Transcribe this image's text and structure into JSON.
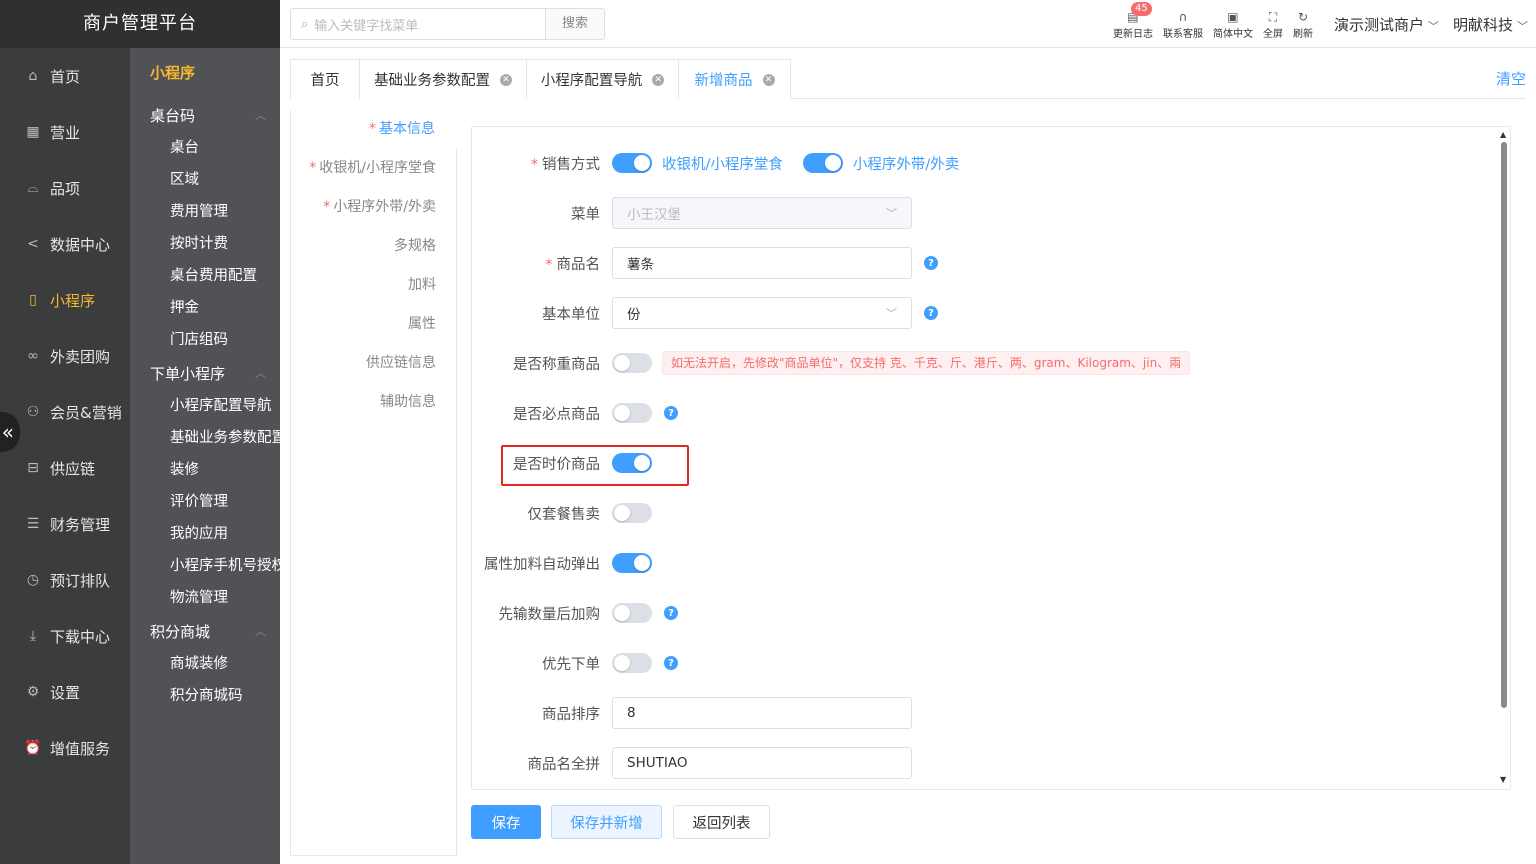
{
  "app_title": "商户管理平台",
  "primary_nav": [
    {
      "label": "首页",
      "icon": "home-icon"
    },
    {
      "label": "营业",
      "icon": "calendar-icon"
    },
    {
      "label": "品项",
      "icon": "bag-icon"
    },
    {
      "label": "数据中心",
      "icon": "share-icon"
    },
    {
      "label": "小程序",
      "icon": "phone-icon",
      "active": true
    },
    {
      "label": "外卖团购",
      "icon": "bike-icon"
    },
    {
      "label": "会员&营销",
      "icon": "user-icon"
    },
    {
      "label": "供应链",
      "icon": "truck-icon"
    },
    {
      "label": "财务管理",
      "icon": "database-icon"
    },
    {
      "label": "预订排队",
      "icon": "clock-icon"
    },
    {
      "label": "下载中心",
      "icon": "download-icon"
    },
    {
      "label": "设置",
      "icon": "gear-icon"
    },
    {
      "label": "增值服务",
      "icon": "alarm-icon"
    }
  ],
  "secondary_nav": {
    "title": "小程序",
    "groups": [
      {
        "label": "桌台码",
        "items": [
          "桌台",
          "区域",
          "费用管理",
          "按时计费",
          "桌台费用配置",
          "押金",
          "门店组码"
        ]
      },
      {
        "label": "下单小程序",
        "items": [
          "小程序配置导航",
          "基础业务参数配置",
          "装修",
          "评价管理",
          "我的应用",
          "小程序手机号授权",
          "物流管理"
        ]
      },
      {
        "label": "积分商城",
        "items": [
          "商城装修",
          "积分商城码"
        ]
      }
    ]
  },
  "header": {
    "search_placeholder": "输入关键字找菜单",
    "search_button": "搜索",
    "icons": [
      {
        "label": "更新日志",
        "icon": "log-icon",
        "badge": "45"
      },
      {
        "label": "联系客服",
        "icon": "headset-icon"
      },
      {
        "label": "简体中文",
        "icon": "language-icon"
      },
      {
        "label": "全屏",
        "icon": "fullscreen-icon"
      },
      {
        "label": "刷新",
        "icon": "refresh-icon"
      }
    ],
    "merchant": "演示测试商户",
    "company": "明献科技"
  },
  "tabs": [
    {
      "label": "首页",
      "closable": false
    },
    {
      "label": "基础业务参数配置",
      "closable": true
    },
    {
      "label": "小程序配置导航",
      "closable": true
    },
    {
      "label": "新增商品",
      "closable": true,
      "active": true
    }
  ],
  "clear_label": "清空",
  "section_nav": [
    {
      "label": "基本信息",
      "required": true,
      "active": true
    },
    {
      "label": "收银机/小程序堂食",
      "required": true
    },
    {
      "label": "小程序外带/外卖",
      "required": true
    },
    {
      "label": "多规格"
    },
    {
      "label": "加料"
    },
    {
      "label": "属性"
    },
    {
      "label": "供应链信息"
    },
    {
      "label": "辅助信息"
    }
  ],
  "form": {
    "sale_mode": {
      "label": "销售方式",
      "opt1": "收银机/小程序堂食",
      "opt2": "小程序外带/外卖"
    },
    "menu": {
      "label": "菜单",
      "value": "小王汉堡"
    },
    "name": {
      "label": "商品名",
      "value": "薯条"
    },
    "unit": {
      "label": "基本单位",
      "value": "份"
    },
    "weighed": {
      "label": "是否称重商品",
      "tip": "如无法开启，先修改\"商品单位\"，仅支持 克、千克、斤、港斤、两、gram、Kilogram、jin、兩"
    },
    "must_order": {
      "label": "是否必点商品"
    },
    "market_price": {
      "label": "是否时价商品"
    },
    "set_only": {
      "label": "仅套餐售卖"
    },
    "auto_popup": {
      "label": "属性加料自动弹出"
    },
    "qty_first": {
      "label": "先输数量后加购"
    },
    "priority": {
      "label": "优先下单"
    },
    "sort": {
      "label": "商品排序",
      "value": "8"
    },
    "pinyin": {
      "label": "商品名全拼",
      "value": "SHUTIAO"
    }
  },
  "buttons": {
    "save": "保存",
    "save_new": "保存并新增",
    "back": "返回列表"
  },
  "colors": {
    "accent": "#409eff",
    "active_nav": "#f5b82e",
    "highlight_border": "#e0281e"
  }
}
